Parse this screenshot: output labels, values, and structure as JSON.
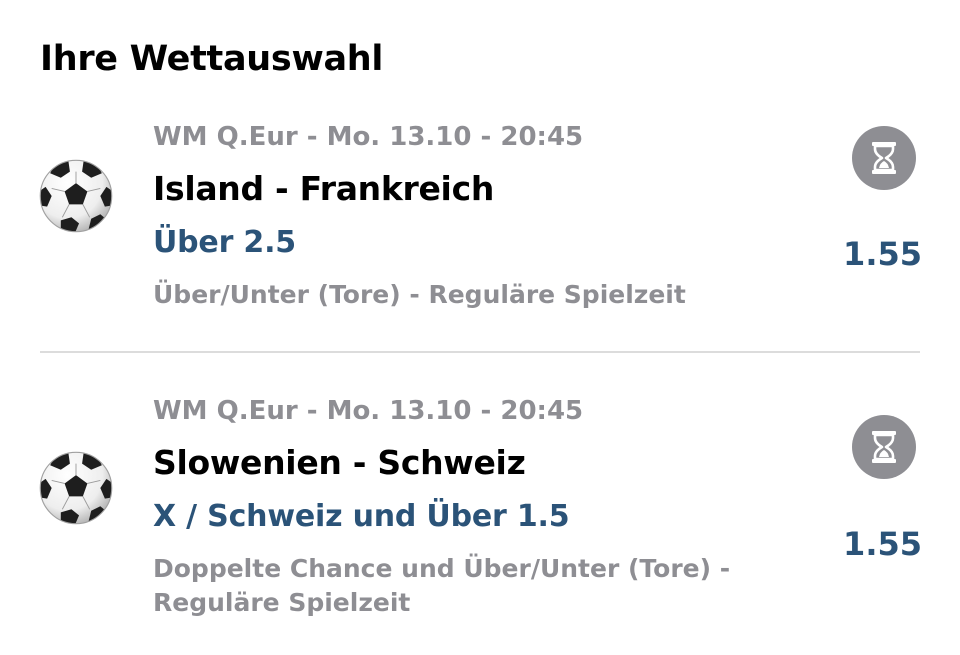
{
  "page": {
    "title": "Ihre Wettauswahl"
  },
  "bets": [
    {
      "sport_icon": "soccer-ball-icon",
      "status_icon": "hourglass-icon",
      "meta": "WM Q.Eur - Mo. 13.10 - 20:45",
      "match": "Island - Frankreich",
      "selection": "Über 2.5",
      "market": "Über/Unter (Tore) - Reguläre Spielzeit",
      "odds": "1.55"
    },
    {
      "sport_icon": "soccer-ball-icon",
      "status_icon": "hourglass-icon",
      "meta": "WM Q.Eur - Mo. 13.10 - 20:45",
      "match": "Slowenien - Schweiz",
      "selection": "X / Schweiz und Über 1.5",
      "market": "Doppelte Chance und Über/Unter (Tore) - Reguläre Spielzeit",
      "odds": "1.55"
    }
  ],
  "colors": {
    "accent": "#2b5378",
    "secondary_text": "#8e8e93",
    "status_badge": "#8e8e93",
    "divider": "#dcdcdc"
  }
}
